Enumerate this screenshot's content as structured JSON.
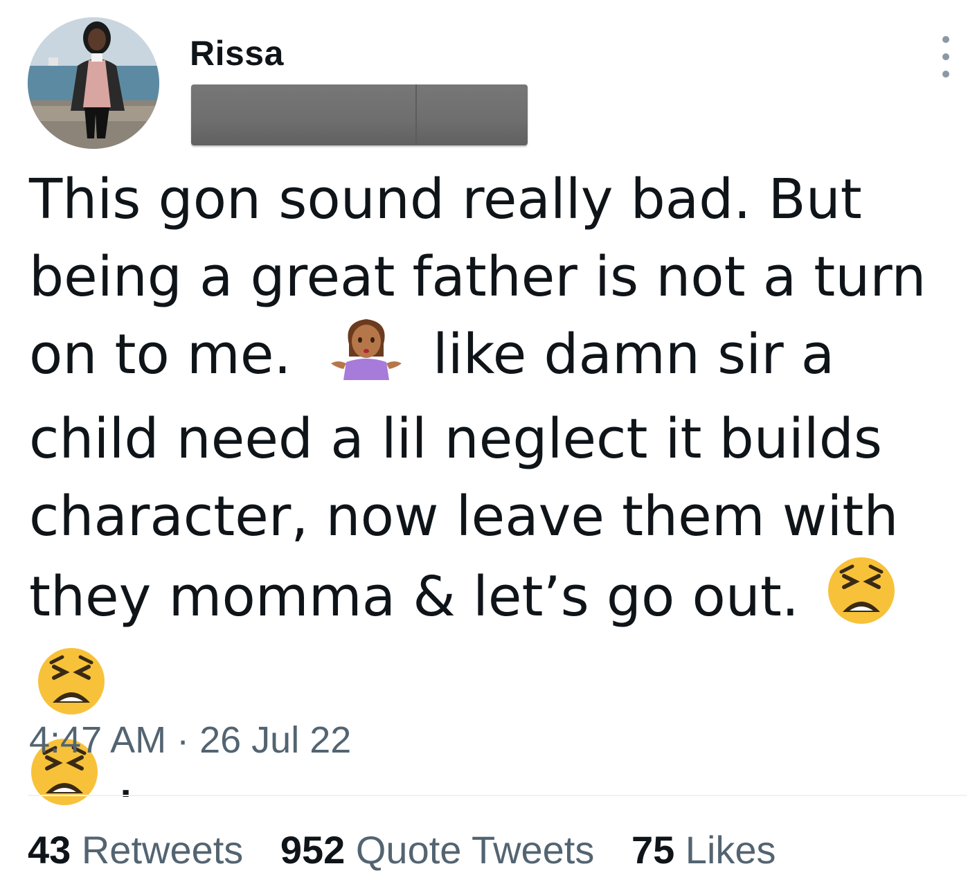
{
  "author": {
    "display_name": "Rissa",
    "avatar_icon": "profile-photo",
    "handle_redacted": true
  },
  "menu": {
    "more_icon": "vertical-ellipsis-icon"
  },
  "tweet": {
    "lines": [
      "This gon sound really bad. But",
      "being a great father is not a turn",
      "on to me.",
      "like damn sir a",
      "child need a lil neglect it builds",
      "character, now leave them with",
      "they momma & let’s go out.",
      "."
    ],
    "emojis": {
      "shrug": "woman-shrugging-emoji",
      "tired": "tired-face-emoji"
    }
  },
  "timestamp": "4:47 AM · 26 Jul 22",
  "stats": {
    "retweets_count": "43",
    "retweets_label": "Retweets",
    "quotes_count": "952",
    "quotes_label": "Quote Tweets",
    "likes_count": "75",
    "likes_label": "Likes"
  },
  "colors": {
    "text_primary": "#0f1419",
    "text_secondary": "#536471",
    "divider": "#eff3f4",
    "redaction": "#6e6e6e"
  }
}
